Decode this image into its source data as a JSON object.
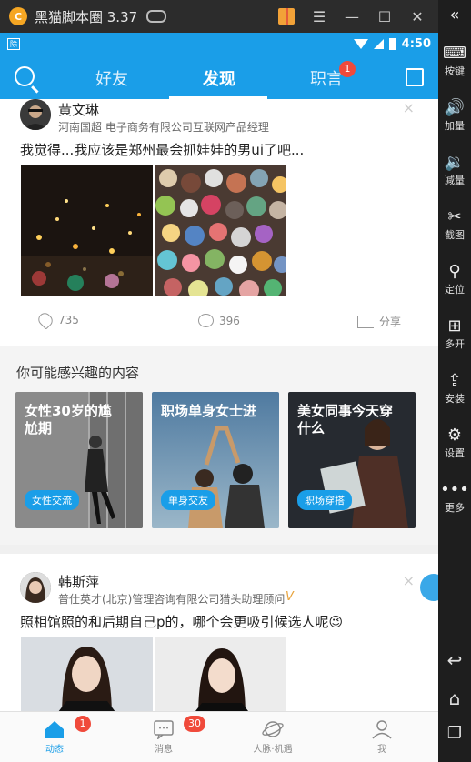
{
  "emulator": {
    "title": "黑猫脚本圈 3.37",
    "logo_glyph": "C",
    "sidebar": [
      {
        "label": "按键",
        "icon": "keyboard-icon",
        "glyph": "⌨"
      },
      {
        "label": "加量",
        "icon": "volume-up-icon",
        "glyph": "🔊"
      },
      {
        "label": "减量",
        "icon": "volume-down-icon",
        "glyph": "🔉"
      },
      {
        "label": "截图",
        "icon": "scissors-icon",
        "glyph": "✂"
      },
      {
        "label": "定位",
        "icon": "location-pin-icon",
        "glyph": "⚲"
      },
      {
        "label": "多开",
        "icon": "multi-open-icon",
        "glyph": "⊞"
      },
      {
        "label": "安装",
        "icon": "apk-install-icon",
        "glyph": "⇪"
      },
      {
        "label": "设置",
        "icon": "gear-icon",
        "glyph": "⚙"
      },
      {
        "label": "更多",
        "icon": "more-dots-icon",
        "glyph": "•••"
      }
    ],
    "nav_keys": {
      "back": "↩",
      "home": "⌂",
      "recents": "❐"
    },
    "window_controls": {
      "menu": "☰",
      "minimize": "—",
      "maximize": "☐",
      "close": "✕",
      "collapse": "«"
    }
  },
  "statusbar": {
    "app_badge": "除",
    "time": "4:50"
  },
  "nav": {
    "tabs": [
      "好友",
      "发现",
      "职言"
    ],
    "active_tab": "发现",
    "zhiyan_badge": "1"
  },
  "post1": {
    "name": "黄文琳",
    "title": "河南国超 电子商务有限公司互联网产品经理",
    "text": "我觉得...我应该是郑州最会抓娃娃的男ui了吧...",
    "likes": "735",
    "comments": "396",
    "share_label": "分享",
    "close": "×"
  },
  "interest": {
    "title": "你可能感兴趣的内容",
    "cards": [
      {
        "title": "女性30岁的尴尬期",
        "tag": "女性交流"
      },
      {
        "title": "职场单身女士进",
        "tag": "单身交友"
      },
      {
        "title": "美女同事今天穿什么",
        "tag": "职场穿搭"
      }
    ]
  },
  "post2": {
    "name": "韩斯萍",
    "title": "普仕英才(北京)管理咨询有限公司猎头助理顾问",
    "verified": "V",
    "text": "照相馆照的和后期自己p的，哪个会更吸引候选人呢😉",
    "close": "×"
  },
  "tabbar": [
    {
      "label": "动态",
      "badge": "1",
      "active": true
    },
    {
      "label": "消息",
      "badge": "30",
      "active": false
    },
    {
      "label": "人脉·机遇",
      "badge": "",
      "active": false
    },
    {
      "label": "我",
      "badge": "",
      "active": false
    }
  ]
}
